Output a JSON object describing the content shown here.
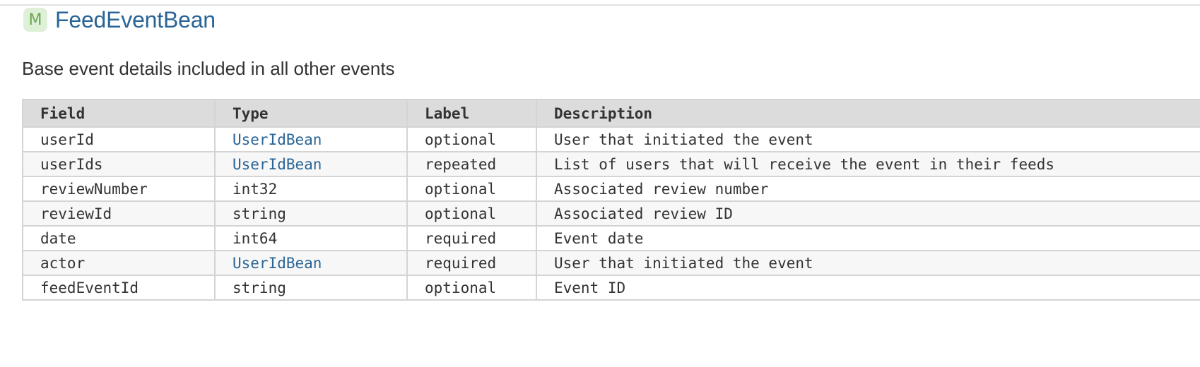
{
  "message": {
    "badge": "M",
    "name": "FeedEventBean",
    "description": "Base event details included in all other events"
  },
  "table": {
    "headers": [
      "Field",
      "Type",
      "Label",
      "Description"
    ],
    "rows": [
      {
        "field": "userId",
        "type": "UserIdBean",
        "type_is_link": true,
        "label": "optional",
        "description": "User that initiated the event"
      },
      {
        "field": "userIds",
        "type": "UserIdBean",
        "type_is_link": true,
        "label": "repeated",
        "description": "List of users that will receive the event in their feeds"
      },
      {
        "field": "reviewNumber",
        "type": "int32",
        "type_is_link": false,
        "label": "optional",
        "description": "Associated review number"
      },
      {
        "field": "reviewId",
        "type": "string",
        "type_is_link": false,
        "label": "optional",
        "description": "Associated review ID"
      },
      {
        "field": "date",
        "type": "int64",
        "type_is_link": false,
        "label": "required",
        "description": "Event date"
      },
      {
        "field": "actor",
        "type": "UserIdBean",
        "type_is_link": true,
        "label": "required",
        "description": "User that initiated the event"
      },
      {
        "field": "feedEventId",
        "type": "string",
        "type_is_link": false,
        "label": "optional",
        "description": "Event ID"
      }
    ]
  },
  "colors": {
    "link": "#2a6496",
    "badge_bg": "#dff0d8",
    "badge_fg": "#6aa84f",
    "header_bg": "#dcdcdc",
    "border": "#d4d4d4"
  }
}
